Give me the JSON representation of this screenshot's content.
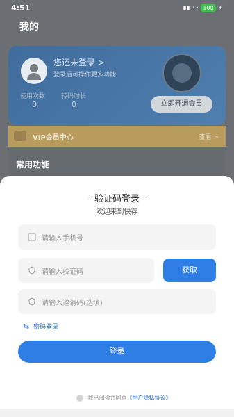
{
  "status": {
    "time": "4:51",
    "battery": "100"
  },
  "page": {
    "title": "我的"
  },
  "member": {
    "login_prompt": "您还未登录 >",
    "login_sub": "登录后可操作更多功能",
    "usage": [
      {
        "label": "使用次数",
        "value": "0"
      },
      {
        "label": "转码时长",
        "value": "0"
      }
    ],
    "open_vip": "立即开通会员"
  },
  "vip": {
    "label": "VIP会员中心",
    "more": "查看 >"
  },
  "section": {
    "title": "常用功能"
  },
  "modal": {
    "title": "- 验证码登录 -",
    "subtitle": "欢迎来到快存",
    "phone_placeholder": "请输入手机号",
    "code_placeholder": "请输入验证码",
    "get_code": "获取",
    "invite_placeholder": "请输入邀请码(选填)",
    "password_login": "密码登录",
    "login_button": "登录",
    "agreement_text": "我已阅读并同意",
    "agreement_link": "《用户隐私协议》"
  },
  "icons": {
    "avatar": "user-icon",
    "badge": "vip-badge-icon",
    "phone": "phone-icon",
    "shield": "shield-icon",
    "swap": "swap-icon",
    "checkbox": "checkbox-icon"
  },
  "colors": {
    "primary": "#2f7ee6",
    "vip_gold": "#b89c5e",
    "card_blue": "#4f7faf"
  }
}
